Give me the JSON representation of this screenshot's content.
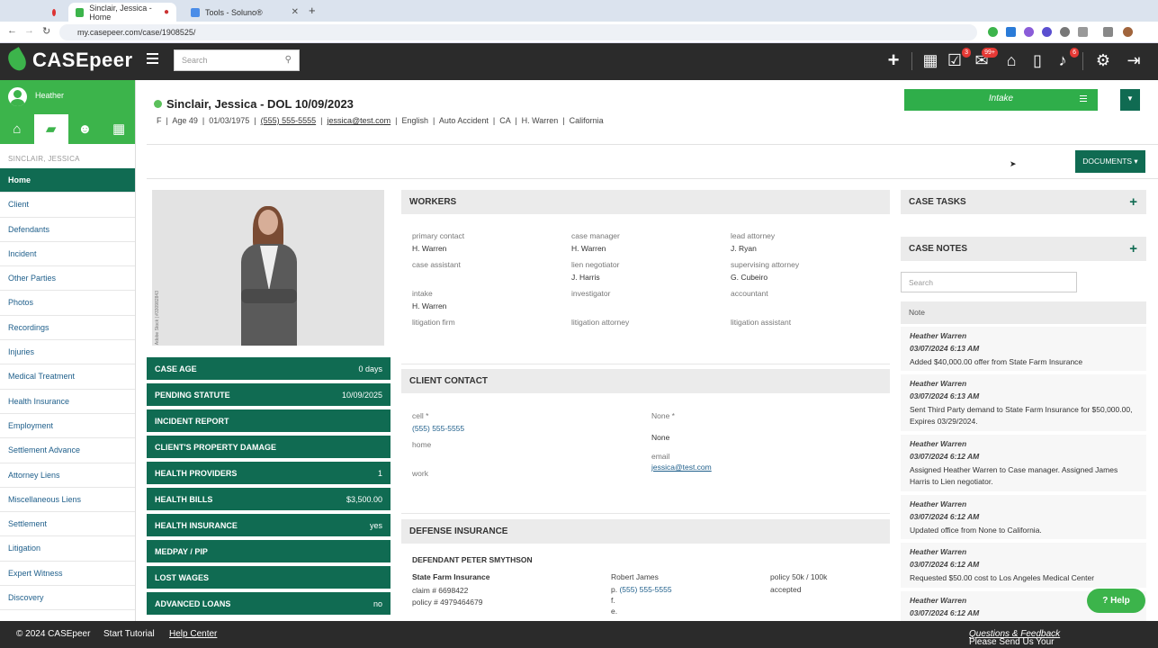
{
  "browser": {
    "tabs": [
      {
        "label": ""
      },
      {
        "label": "Sinclair, Jessica - Home"
      },
      {
        "label": "Tools - Soluno®"
      }
    ],
    "url": "my.casepeer.com/case/1908525/"
  },
  "topbar": {
    "brand": "CASEpeer",
    "search_placeholder": "Search",
    "badges": {
      "tasks": "3",
      "mail": "99+",
      "alerts": "6"
    }
  },
  "sidebar": {
    "user": "Heather",
    "case_label": "SINCLAIR, JESSICA",
    "items": [
      {
        "label": "Home",
        "active": true
      },
      {
        "label": "Client"
      },
      {
        "label": "Defendants"
      },
      {
        "label": "Incident"
      },
      {
        "label": "Other Parties"
      },
      {
        "label": "Photos"
      },
      {
        "label": "Recordings"
      },
      {
        "label": "Injuries"
      },
      {
        "label": "Medical Treatment"
      },
      {
        "label": "Health Insurance"
      },
      {
        "label": "Employment"
      },
      {
        "label": "Settlement Advance"
      },
      {
        "label": "Attorney Liens"
      },
      {
        "label": "Miscellaneous Liens"
      },
      {
        "label": "Settlement"
      },
      {
        "label": "Litigation"
      },
      {
        "label": "Expert Witness"
      },
      {
        "label": "Discovery"
      }
    ]
  },
  "case": {
    "title": "Sinclair, Jessica - DOL 10/09/2023",
    "sex": "F",
    "age": "Age 49",
    "dob": "01/03/1975",
    "phone": "(555) 555-5555",
    "email": "jessica@test.com",
    "language": "English",
    "case_type": "Auto Accident",
    "state": "CA",
    "attorney": "H. Warren",
    "office": "California",
    "status_button": "Intake",
    "documents_button": "DOCUMENTS ▾",
    "photo_watermark": "Adobe Stock | #330982843"
  },
  "stats": [
    {
      "label": "CASE AGE",
      "value": "0 days"
    },
    {
      "label": "PENDING STATUTE",
      "value": "10/09/2025"
    },
    {
      "label": "INCIDENT REPORT",
      "value": ""
    },
    {
      "label": "CLIENT'S PROPERTY DAMAGE",
      "value": ""
    },
    {
      "label": "HEALTH PROVIDERS",
      "value": "1"
    },
    {
      "label": "HEALTH BILLS",
      "value": "$3,500.00"
    },
    {
      "label": "HEALTH INSURANCE",
      "value": "yes"
    },
    {
      "label": "MEDPAY / PIP",
      "value": ""
    },
    {
      "label": "LOST WAGES",
      "value": ""
    },
    {
      "label": "ADVANCED LOANS",
      "value": "no"
    }
  ],
  "workers": {
    "title": "WORKERS",
    "fields": [
      {
        "label": "primary contact",
        "value": "H. Warren"
      },
      {
        "label": "case manager",
        "value": "H. Warren"
      },
      {
        "label": "lead attorney",
        "value": "J. Ryan"
      },
      {
        "label": "case assistant",
        "value": ""
      },
      {
        "label": "lien negotiator",
        "value": "J. Harris"
      },
      {
        "label": "supervising attorney",
        "value": "G. Cubeiro"
      },
      {
        "label": "intake",
        "value": "H. Warren"
      },
      {
        "label": "investigator",
        "value": ""
      },
      {
        "label": "accountant",
        "value": ""
      },
      {
        "label": "litigation firm",
        "value": ""
      },
      {
        "label": "litigation attorney",
        "value": ""
      },
      {
        "label": "litigation assistant",
        "value": ""
      }
    ]
  },
  "client_contact": {
    "title": "CLIENT CONTACT",
    "cell_label": "cell *",
    "cell_value": "(555) 555-5555",
    "home_label": "home",
    "work_label": "work",
    "none_label": "None *",
    "none_value": "None",
    "email_label": "email",
    "email_value": "jessica@test.com"
  },
  "defense": {
    "title": "DEFENSE INSURANCE",
    "defendant": "DEFENDANT PETER SMYTHSON",
    "insurer": "State Farm Insurance",
    "claim": "claim # 6698422",
    "policy": "policy # 4979464679",
    "adjuster": "Robert James",
    "phone_prefix": "p.",
    "phone": "(555) 555-5555",
    "fax_prefix": "f.",
    "email_prefix": "e.",
    "limits": "policy 50k / 100k",
    "status": "accepted"
  },
  "tasks": {
    "title": "CASE TASKS"
  },
  "notes": {
    "title": "CASE NOTES",
    "search_placeholder": "Search",
    "column": "Note",
    "items": [
      {
        "author": "Heather Warren",
        "time": "03/07/2024 6:13 AM",
        "text": "Added $40,000.00 offer from State Farm Insurance"
      },
      {
        "author": "Heather Warren",
        "time": "03/07/2024 6:13 AM",
        "text": "Sent Third Party demand to State Farm Insurance for $50,000.00, Expires 03/29/2024."
      },
      {
        "author": "Heather Warren",
        "time": "03/07/2024 6:12 AM",
        "text": "Assigned Heather Warren to Case manager. Assigned James Harris to Lien negotiator."
      },
      {
        "author": "Heather Warren",
        "time": "03/07/2024 6:12 AM",
        "text": "Updated office from None to California."
      },
      {
        "author": "Heather Warren",
        "time": "03/07/2024 6:12 AM",
        "text": "Requested $50.00 cost to Los Angeles Medical Center"
      },
      {
        "author": "Heather Warren",
        "time": "03/07/2024 6:12 AM",
        "text": ""
      }
    ]
  },
  "help_button": "Help",
  "footer": {
    "copyright": "© 2024 CASEpeer",
    "tutorial": "Start Tutorial",
    "help_center": "Help Center",
    "feedback_prefix": "Please Send Us Your",
    "feedback_link": "Questions & Feedback"
  }
}
